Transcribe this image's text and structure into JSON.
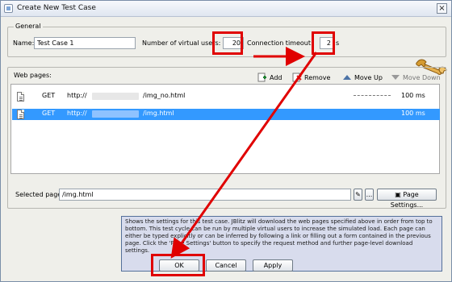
{
  "window": {
    "title": "Create New Test Case",
    "close_glyph": "×"
  },
  "general": {
    "legend": "General",
    "name_label": "Name:",
    "name_value": "Test Case 1",
    "virtual_users_label": "Number of virtual users:",
    "virtual_users_value": "20",
    "connection_timeout_label": "Connection timeout:",
    "connection_timeout_value": "2",
    "connection_timeout_unit": "s",
    "tool_icon": "wrench-icon"
  },
  "web_pages": {
    "legend": "Web pages:",
    "toolbar": {
      "add": "Add",
      "remove": "Remove",
      "move_up": "Move Up",
      "move_down": "Move Down"
    },
    "rows": [
      {
        "method": "GET",
        "url_prefix": "http://",
        "url_suffix": "/img_no.html",
        "timing": "100 ms",
        "selected": false
      },
      {
        "method": "GET",
        "url_prefix": "http://",
        "url_suffix": "/img.html",
        "timing": "100 ms",
        "selected": true
      }
    ],
    "selected_page_label": "Selected page:",
    "selected_page_value": "/img.html",
    "small_button_1": "✎",
    "small_button_2": "...",
    "page_settings": "Page Settings..."
  },
  "info_text": "Shows the settings for this test case. JBlitz will download the web pages specified above in order from top to bottom. This test cycle can be run by multiple virtual users to increase the simulated load. Each page can either be typed explicitly or can be inferred by following a link or filling out a form contained in the previous page. Click the 'Page Settings' button to specify the request method and further page-level download settings.",
  "buttons": {
    "ok": "OK",
    "cancel": "Cancel",
    "apply": "Apply"
  },
  "colors": {
    "highlight": "#e00000",
    "selection": "#3399ff",
    "info_bg": "#d8dced"
  }
}
